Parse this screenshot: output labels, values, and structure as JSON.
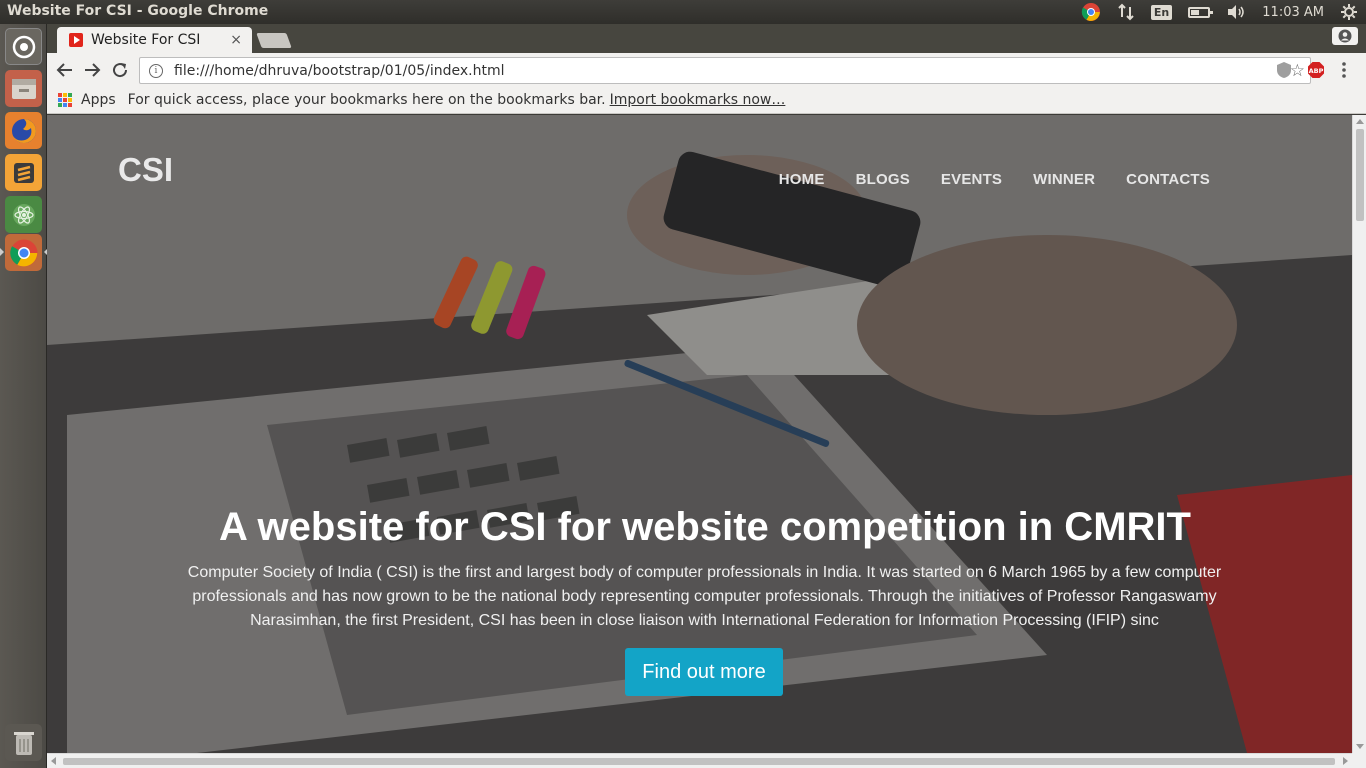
{
  "window": {
    "title": "Website For CSI - Google Chrome"
  },
  "system_tray": {
    "keyboard_layout": "En",
    "clock": "11:03 AM",
    "battery_level": 0.5
  },
  "launcher": {
    "items": [
      {
        "name": "Ubuntu Dash",
        "icon": "dash-icon"
      },
      {
        "name": "Files",
        "icon": "files-icon"
      },
      {
        "name": "Firefox",
        "icon": "firefox-icon"
      },
      {
        "name": "Sublime Text",
        "icon": "sublime-icon"
      },
      {
        "name": "Atom",
        "icon": "atom-icon"
      },
      {
        "name": "Google Chrome",
        "icon": "chrome-icon"
      },
      {
        "name": "Trash",
        "icon": "trash-icon"
      }
    ]
  },
  "browser": {
    "tab": {
      "title": "Website For CSI",
      "close": "×"
    },
    "url": "file:///home/dhruva/bootstrap/01/05/index.html",
    "bookmarks_bar": {
      "apps_label": "Apps",
      "message": "For quick access, place your bookmarks here on the bookmarks bar.",
      "import_link": "Import bookmarks now…"
    },
    "extensions": {
      "abp_label": "ABP"
    }
  },
  "page": {
    "brand": "CSI",
    "nav": [
      "HOME",
      "BLOGS",
      "EVENTS",
      "WINNER",
      "CONTACTS"
    ],
    "hero": {
      "title": "A website for CSI for website competition in CMRIT",
      "text": "Computer Society of India ( CSI) is the first and largest body of computer professionals in India. It was started on 6 March 1965 by a few computer professionals and has now grown to be the national body representing computer professionals. Through the initiatives of Professor Rangaswamy Narasimhan, the first President, CSI has been in close liaison with International Federation for Information Processing (IFIP) sinc",
      "button": "Find out more"
    }
  },
  "colors": {
    "cta": "#13a4c7",
    "panel": "#3c3b37",
    "chrome_toolbar": "#f2f1ef"
  }
}
